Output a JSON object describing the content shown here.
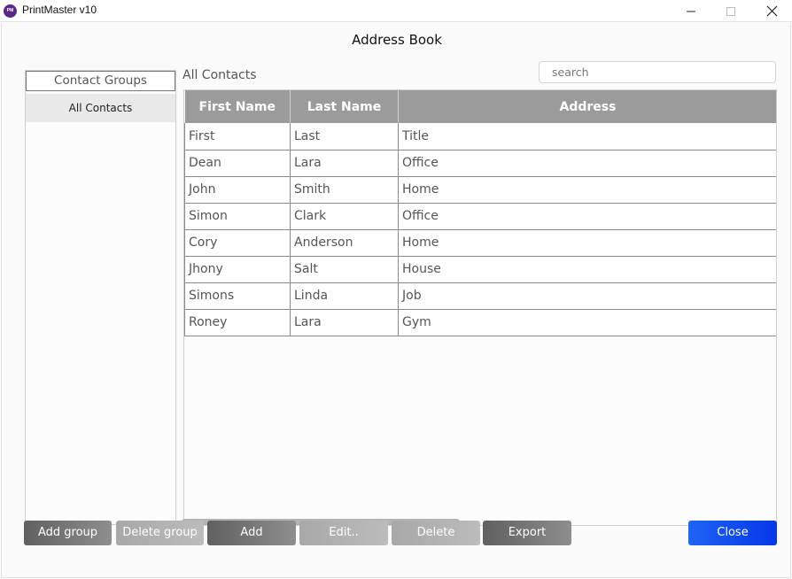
{
  "window": {
    "logo_text": "PM",
    "title": "PrintMaster v10",
    "controls": [
      "minimize",
      "maximize",
      "close"
    ]
  },
  "dialog": {
    "title": "Address Book"
  },
  "groups": {
    "header": "Contact Groups",
    "items": [
      "All Contacts"
    ],
    "selected": "All Contacts"
  },
  "contacts": {
    "title": "All Contacts",
    "search_placeholder": "search",
    "search_value": "",
    "columns": [
      "First Name",
      "Last Name",
      "Address"
    ],
    "rows": [
      [
        "First",
        "Last",
        "Title"
      ],
      [
        "Dean",
        "Lara",
        "Office"
      ],
      [
        "John",
        "Smith",
        "Home"
      ],
      [
        "Simon",
        "Clark",
        "Office"
      ],
      [
        "Cory",
        "Anderson",
        "Home"
      ],
      [
        "Jhony",
        "Salt",
        "House"
      ],
      [
        "Simons",
        "Linda",
        "Job"
      ],
      [
        "Roney",
        "Lara",
        "Gym"
      ]
    ]
  },
  "buttons": {
    "add_group": "Add group",
    "delete_group": "Delete group",
    "add": "Add",
    "edit": "Edit..",
    "delete": "Delete",
    "export": "Export",
    "close": "Close"
  },
  "colors": {
    "header_bg": "#9b9b9b",
    "primary_button": "#0f4cf0",
    "dark_button": "#6e6e6e",
    "disabled_button": "#b0b0b0",
    "logo": "#5b2a86"
  },
  "icons": {
    "minimize": "minimize-icon",
    "maximize": "maximize-icon",
    "close": "close-icon"
  }
}
